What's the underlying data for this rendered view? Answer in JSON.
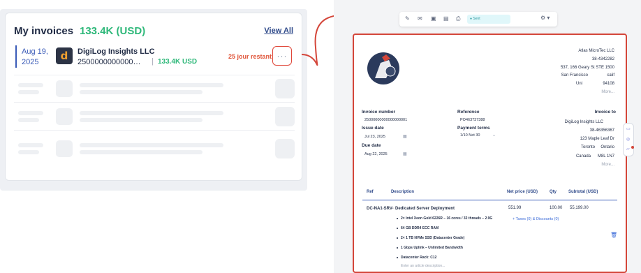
{
  "invoices_card": {
    "title": "My invoices",
    "total": "133.4K (USD)",
    "view_all": "View All",
    "invoice": {
      "date_line1": "Aug 19,",
      "date_line2": "2025",
      "client": "DigiLog Insights LLC",
      "number": "2500000000000…",
      "separator": "|",
      "amount": "133.4K USD",
      "status": "25 jour restant",
      "more": "···"
    }
  },
  "toolbar": {
    "icons": [
      "magic-icon",
      "mail-icon",
      "preview-icon",
      "save-icon",
      "print-icon"
    ],
    "status_select": "● Sent",
    "settings": "⚙ ▾"
  },
  "document": {
    "sender": {
      "name": "Atlas MicroTec LLC",
      "phone": "38-4342282",
      "street": "537, 166 Geary St STE 1500",
      "city": "San Francisco",
      "state": "calif",
      "country": "Uni",
      "zip": "94108",
      "more": "More..."
    },
    "invoice_number_label": "Invoice number",
    "invoice_number": "25000000000000000001",
    "issue_date_label": "Issue date",
    "issue_date": "Jul 23, 2025",
    "due_date_label": "Due date",
    "due_date": "Aug 22, 2025",
    "reference_label": "Reference",
    "reference": "PO463737388",
    "payment_terms_label": "Payment terms",
    "payment_terms": "1/10 Net 30",
    "invoice_to_label": "Invoice to",
    "recipient": {
      "name": "DigiLog Insights LLC",
      "phone": "38-46356367",
      "street": "123 Maple Leaf Dr",
      "city": "Toronto",
      "province": "Ontario",
      "country": "Canada",
      "postal": "M8L 1N7",
      "more": "More..."
    },
    "table": {
      "headers": [
        "Ref",
        "Description",
        "Net price (USD)",
        "Qty",
        "Subtotal (USD)"
      ],
      "row": {
        "ref": "DC-NA1-SRV-",
        "description": "Dedicated Server Deployment",
        "net_price": "551.99",
        "qty": "100.00",
        "subtotal": "55,199.00",
        "taxes_link": "+ Taxes (0) & Discounts (0)",
        "details": [
          "2× Intel Xeon Gold 6226R – 16 cores / 32 threads – 2.9G",
          "64 GB DDR4 ECC RAM",
          "2× 1 TB NVMe SSD (Datacenter Grade)",
          "1 Gbps Uplink – Unlimited Bandwidth",
          "Datacenter Rack: C12"
        ],
        "description_placeholder": "Enter an article description..."
      }
    }
  }
}
